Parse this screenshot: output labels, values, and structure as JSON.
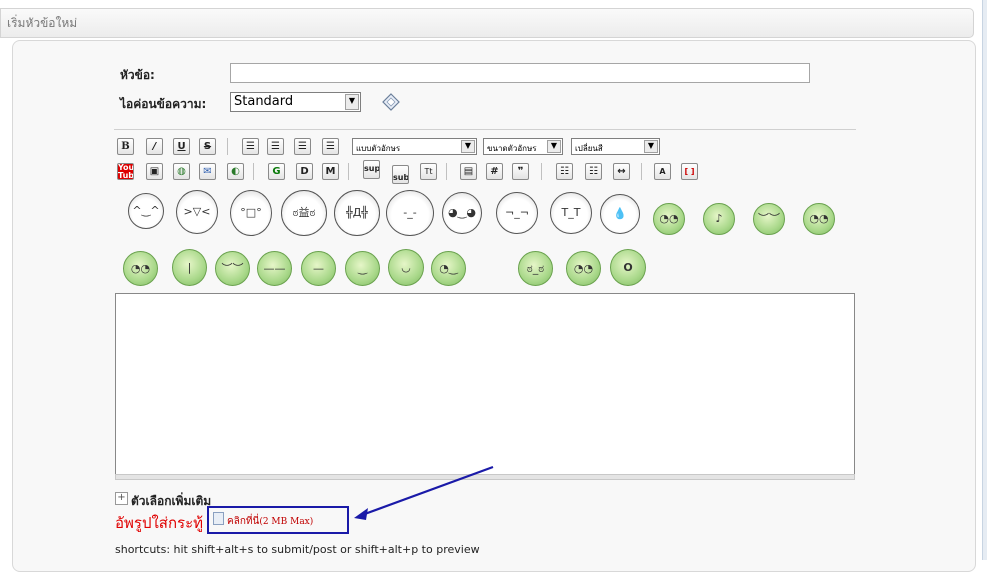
{
  "header": {
    "title": "เริ่มหัวข้อใหม่"
  },
  "form": {
    "title_label": "หัวข้อ:",
    "title_value": "",
    "icon_label": "ไอค่อนข้อความ:",
    "icon_value": "Standard"
  },
  "toolbar": {
    "row1": [
      "B",
      "I",
      "U",
      "S",
      "align-left",
      "align-center",
      "align-right",
      "justify"
    ],
    "font_select": "แบบตัวอักษร",
    "size_select": "ขนาดตัวอักษร",
    "color_select": "เปลี่ยนสี",
    "row2": [
      "You Tube",
      "image",
      "link",
      "email",
      "unlink",
      "G",
      "D",
      "M",
      "sup",
      "sub",
      "Tt",
      "table",
      "#",
      "quote",
      "ul",
      "ol",
      "hr",
      "removeformat",
      "code"
    ],
    "sup_label": "sup",
    "sub_label": "sub"
  },
  "editor": {
    "value": ""
  },
  "options": {
    "more_label": "ตัวเลือกเพิ่มเติม"
  },
  "upload": {
    "label": "อัพรูปใส่กระทู้",
    "link_text": "คลิกที่นี่",
    "link_note": "(2 MB Max)"
  },
  "footer": {
    "shortcuts": "shortcuts: hit shift+alt+s to submit/post or shift+alt+p to preview"
  },
  "colors": {
    "annotation": "#1a1aa8",
    "upload_label": "#e00000"
  }
}
